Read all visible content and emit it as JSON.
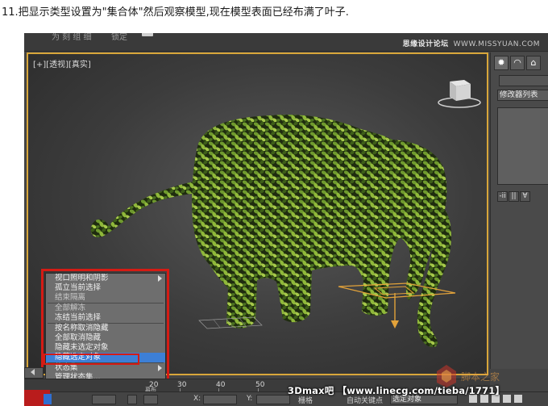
{
  "caption": "11.把显示类型设置为\"集合体\"然后观察模型,现在模型表面已经布满了叶子.",
  "topbar": {
    "menu_faded_1": "为 刻 组 细",
    "menu_faded_2": "锁定",
    "watermark_text": "思缘设计论坛",
    "watermark_url": "WWW.MISSYUAN.COM"
  },
  "viewport": {
    "label": "[+][透视][真实]",
    "border_color": "#d8a63a"
  },
  "quad_menu": {
    "items": [
      {
        "label": "视口照明和阴影",
        "submenu": true,
        "dim": false
      },
      {
        "label": "孤立当前选择",
        "submenu": false,
        "dim": false
      },
      {
        "label": "结束隔离",
        "submenu": false,
        "dim": true
      },
      {
        "label": "全部解冻",
        "submenu": false,
        "dim": true
      },
      {
        "label": "冻结当前选择",
        "submenu": false,
        "dim": false
      },
      {
        "label": "按名称取消隐藏",
        "submenu": false,
        "dim": false
      },
      {
        "label": "全部取消隐藏",
        "submenu": false,
        "dim": false
      },
      {
        "label": "隐藏未选定对象",
        "submenu": false,
        "dim": false
      },
      {
        "label": "隐藏选定对象",
        "submenu": false,
        "dim": false,
        "selected": true
      },
      {
        "label": "状态集",
        "submenu": true,
        "dim": false
      },
      {
        "label": "管理状态集...",
        "submenu": false,
        "dim": false
      }
    ],
    "highlight_color": "#d51b14",
    "selected_color": "#3d7fd6"
  },
  "command_panel": {
    "modifier_list_label": "修改器列表",
    "tools": [
      "-ii",
      "||",
      "∀",
      "∂",
      "▣"
    ]
  },
  "timeline": {
    "ticks": [
      "20",
      "30",
      "40",
      "50"
    ],
    "slider_text": "幕布"
  },
  "status_bar": {
    "x_label": "X:",
    "y_label": "Y:",
    "grid_label": "栅格",
    "auto_key_label": "自动关键点",
    "selected_label": "选定对象"
  },
  "site_watermark": "3Dmax吧 【www.linecg.com/tieba/1771】",
  "logo_text": "脚本之家"
}
